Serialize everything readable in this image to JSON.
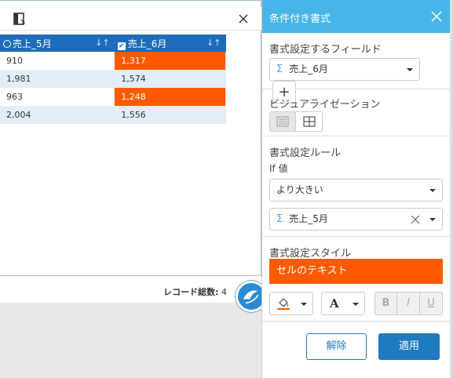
{
  "grid": {
    "columns": [
      {
        "label": "売上_5月",
        "sort_icon": "sort-icon"
      },
      {
        "label": "売上_6月",
        "sort_icon": "sort-icon"
      }
    ],
    "rows": [
      {
        "c1": "910",
        "c2": "1,317",
        "highlight": true
      },
      {
        "c1": "1,981",
        "c2": "1,574",
        "highlight": false
      },
      {
        "c1": "963",
        "c2": "1,248",
        "highlight": true
      },
      {
        "c1": "2,004",
        "c2": "1,556",
        "highlight": false
      }
    ],
    "footer": {
      "record_label": "レコード総数:",
      "record_count": "4"
    }
  },
  "panel": {
    "title": "条件付き書式",
    "field_section": {
      "title": "書式設定するフィールド",
      "selected_field": "売上_6月",
      "add_button": "+"
    },
    "visualization": {
      "title": "ビジュアライゼーション"
    },
    "rule": {
      "title": "書式設定ルール",
      "if_label": "If 値",
      "operator": "より大きい",
      "compare_field": "売上_5月"
    },
    "style": {
      "title": "書式設定スタイル",
      "preview_text": "セルのテキスト",
      "preview_color": "#ff5a00",
      "font_icon": "A",
      "bold": "B",
      "italic": "I",
      "underline": "U"
    },
    "buttons": {
      "clear": "解除",
      "apply": "適用"
    }
  },
  "colors": {
    "header_blue": "#1f6dba",
    "panel_header": "#48b5e8",
    "highlight": "#ff5a00",
    "accent": "#1f7ac0"
  }
}
